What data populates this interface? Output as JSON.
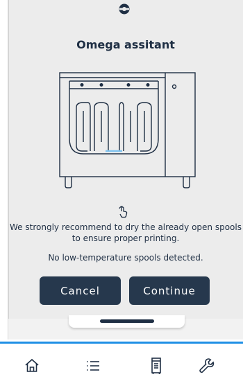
{
  "dialog": {
    "title": "Omega assitant",
    "recommendation": "We strongly recommend to dry the already open spools to ensure proper printing.",
    "status": "No low-temperature spools detected.",
    "cancel_label": "Cancel",
    "continue_label": "Continue"
  },
  "icons": {
    "logo": "brand-logo-icon",
    "illustration": "printer-drawer-illustration",
    "tap": "tap-hand-icon"
  },
  "tab_bar": {
    "items": [
      {
        "name": "home",
        "icon": "home-icon"
      },
      {
        "name": "list",
        "icon": "list-icon"
      },
      {
        "name": "device",
        "icon": "device-icon"
      },
      {
        "name": "tools",
        "icon": "wrench-icon"
      }
    ],
    "accent_color": "#1f8fe5"
  },
  "colors": {
    "primary": "#26384d",
    "text": "#1f2f44",
    "background": "#ececec"
  }
}
